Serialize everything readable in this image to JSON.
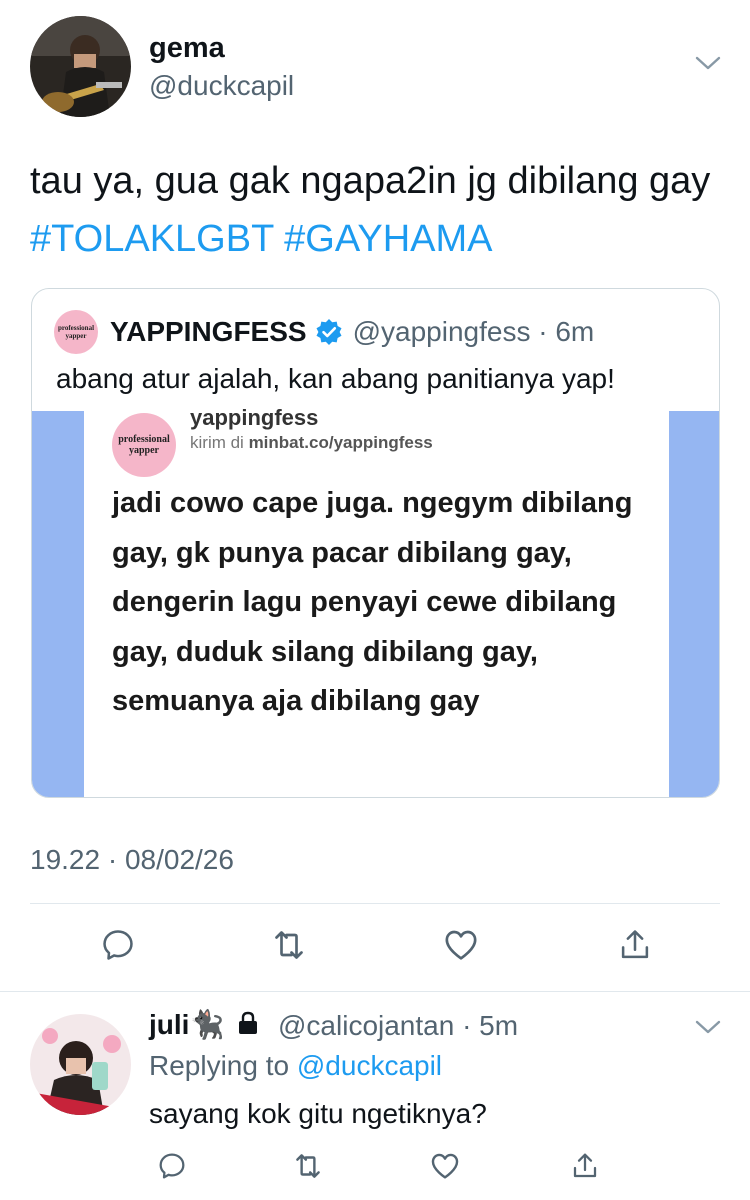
{
  "tweet": {
    "author_name": "gema",
    "author_handle": "@duckcapil",
    "text_plain": "tau ya, gua gak ngapa2in jg dibilang gay ",
    "hashtag_1": "#TOLAKLGBT",
    "hashtag_2": "#GAYHAMA",
    "timestamp": "19.22 · 08/02/26"
  },
  "quote": {
    "avatar_line_1": "professional",
    "avatar_line_2": "yapper",
    "name": "YAPPINGFESS",
    "handle_time": "@yappingfess · 6m",
    "text": "abang atur ajalah, kan abang panitianya yap!",
    "image": {
      "avatar_line_1": "professional",
      "avatar_line_2": "yapper",
      "name": "yappingfess",
      "sub_prefix": "kirim di ",
      "sub_link": "minbat.co/yappingfess",
      "body": "jadi cowo cape juga. ngegym dibilang gay, gk punya pacar dibilang gay, dengerin lagu penyayi cewe dibilang gay, duduk silang dibilang gay, semuanya aja dibilang gay"
    }
  },
  "reply": {
    "author_name": "juli🐈‍⬛",
    "author_handle_time": "@calicojantan · 5m",
    "replying_prefix": "Replying to ",
    "replying_to": "@duckcapil",
    "text": "sayang kok gitu ngetiknya?"
  },
  "icons": [
    "reply-icon",
    "retweet-icon",
    "like-icon",
    "share-icon",
    "chevron-down-icon",
    "verified-icon",
    "lock-icon"
  ],
  "colors": {
    "accent": "#1d9bf0",
    "secondary_text": "#536471",
    "divider": "#e1e8ed",
    "quote_bg_side": "#95b6f2"
  }
}
